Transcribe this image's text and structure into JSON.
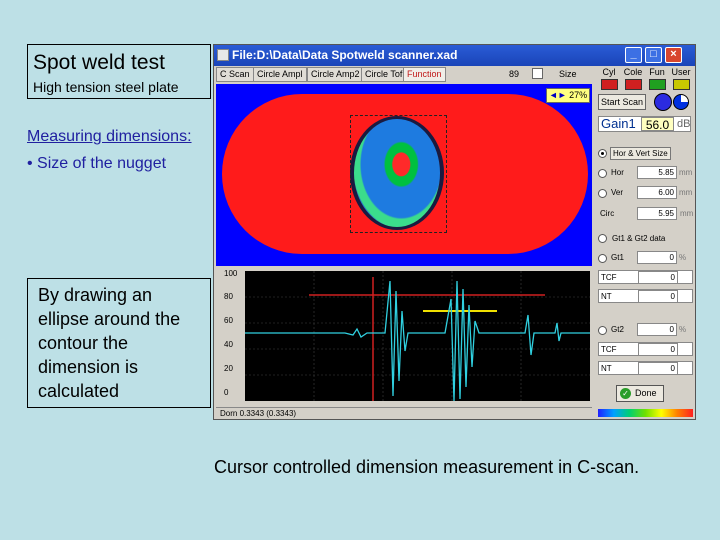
{
  "slide": {
    "title": "Spot weld test",
    "subtitle": "High tension steel plate",
    "measuring_heading": "Measuring dimensions:",
    "measuring_bullet": "• Size of the nugget",
    "draw_text": [
      "By drawing an",
      "ellipse around the",
      "contour the",
      "dimension is",
      "calculated"
    ],
    "caption": "Cursor controlled dimension measurement in C-scan."
  },
  "window": {
    "title": "File:D:\\Data\\Data Spotweld scanner.xad",
    "controls": {
      "minimize": "_",
      "maximize": "□",
      "close": "×"
    }
  },
  "tabs": [
    {
      "label": "C Scan"
    },
    {
      "label": "Circle Ampl"
    },
    {
      "label": "Circle Amp2"
    },
    {
      "label": "Circle Tof"
    },
    {
      "label": "Function"
    }
  ],
  "tab_values": {
    "v1": "89",
    "v2": "Size"
  },
  "cscan": {
    "gain_readout": "27%"
  },
  "ascan": {
    "y_ticks": [
      "100",
      "80",
      "60",
      "40",
      "20",
      "0"
    ],
    "status": "Dorn 0.3343 (0.3343)"
  },
  "panel": {
    "color_buttons": [
      {
        "label": "Cyl",
        "color": "#d02020"
      },
      {
        "label": "Cole",
        "color": "#d02020"
      },
      {
        "label": "Fun",
        "color": "#20a020"
      },
      {
        "label": "User",
        "color": "#c8c800"
      }
    ],
    "start_scan": "Start Scan",
    "gain": {
      "label": "Gain1",
      "value": "56.0",
      "unit": "dB"
    },
    "size_option": "Hor & Vert Size",
    "hor": {
      "label": "Hor",
      "value": "5.85",
      "unit": "mm"
    },
    "ver": {
      "label": "Ver",
      "value": "6.00",
      "unit": "mm"
    },
    "circ": {
      "label": "Circ",
      "value": "5.95",
      "unit": "mm"
    },
    "gate_option": "Gt1 & Gt2 data",
    "gt1": {
      "label": "Gt1",
      "value": "0",
      "unit": "%"
    },
    "gt1_tcf": {
      "label": "TCF",
      "value": "0"
    },
    "gt1_nt": {
      "label": "NT",
      "value": "0"
    },
    "gt2": {
      "label": "Gt2",
      "value": "0",
      "unit": "%"
    },
    "gt2_tcf": {
      "label": "TCF",
      "value": "0"
    },
    "gt2_nt": {
      "label": "NT",
      "value": "0"
    },
    "done": "Done"
  }
}
